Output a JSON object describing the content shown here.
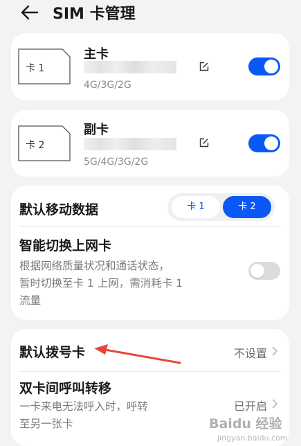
{
  "header": {
    "title": "SIM 卡管理",
    "back_icon": "arrow-left-icon"
  },
  "sims": [
    {
      "icon_label": "卡 1",
      "name": "主卡",
      "network": "4G/3G/2G",
      "enabled": true
    },
    {
      "icon_label": "卡 2",
      "name": "副卡",
      "network": "5G/4G/3G/2G",
      "enabled": true
    }
  ],
  "mobile_data": {
    "label": "默认移动数据",
    "options": [
      "卡 1",
      "卡 2"
    ],
    "selected": "卡 2"
  },
  "smart_switch": {
    "title": "智能切换上网卡",
    "description": [
      "根据网络质量状况和通话状态，",
      "暂时切换至卡 1 上网，需消耗卡 1",
      "流量"
    ],
    "enabled": false
  },
  "default_dial": {
    "label": "默认拨号卡",
    "value": "不设置"
  },
  "call_forward": {
    "title": "双卡间呼叫转移",
    "description": [
      "一卡来电无法呼入时，呼转",
      "至另一张卡"
    ],
    "value": "已开启"
  },
  "watermark": {
    "text": "Baidu 经验",
    "url": "jingyan.baidu.com"
  },
  "colors": {
    "accent": "#0a59f7",
    "background": "#f1f3f5",
    "annotation_arrow": "#e8463a"
  }
}
